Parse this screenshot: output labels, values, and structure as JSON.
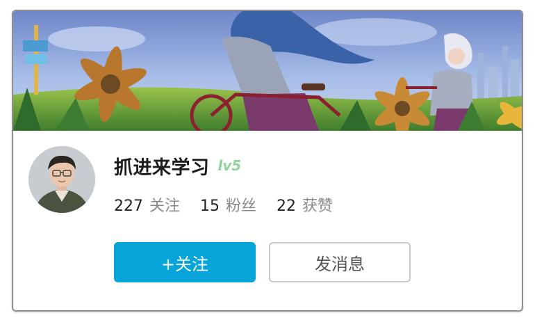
{
  "profile": {
    "username": "抓进来学习",
    "level": "lv5",
    "level_color": "#8fd49a"
  },
  "stats": [
    {
      "value": "227",
      "label": "关注"
    },
    {
      "value": "15",
      "label": "粉丝"
    },
    {
      "value": "22",
      "label": "获赞"
    }
  ],
  "actions": {
    "follow_label": "+关注",
    "message_label": "发消息",
    "follow_color": "#06a4d8"
  },
  "icons": {
    "banner": "anime-banner-illustration",
    "avatar": "user-avatar-photo"
  }
}
